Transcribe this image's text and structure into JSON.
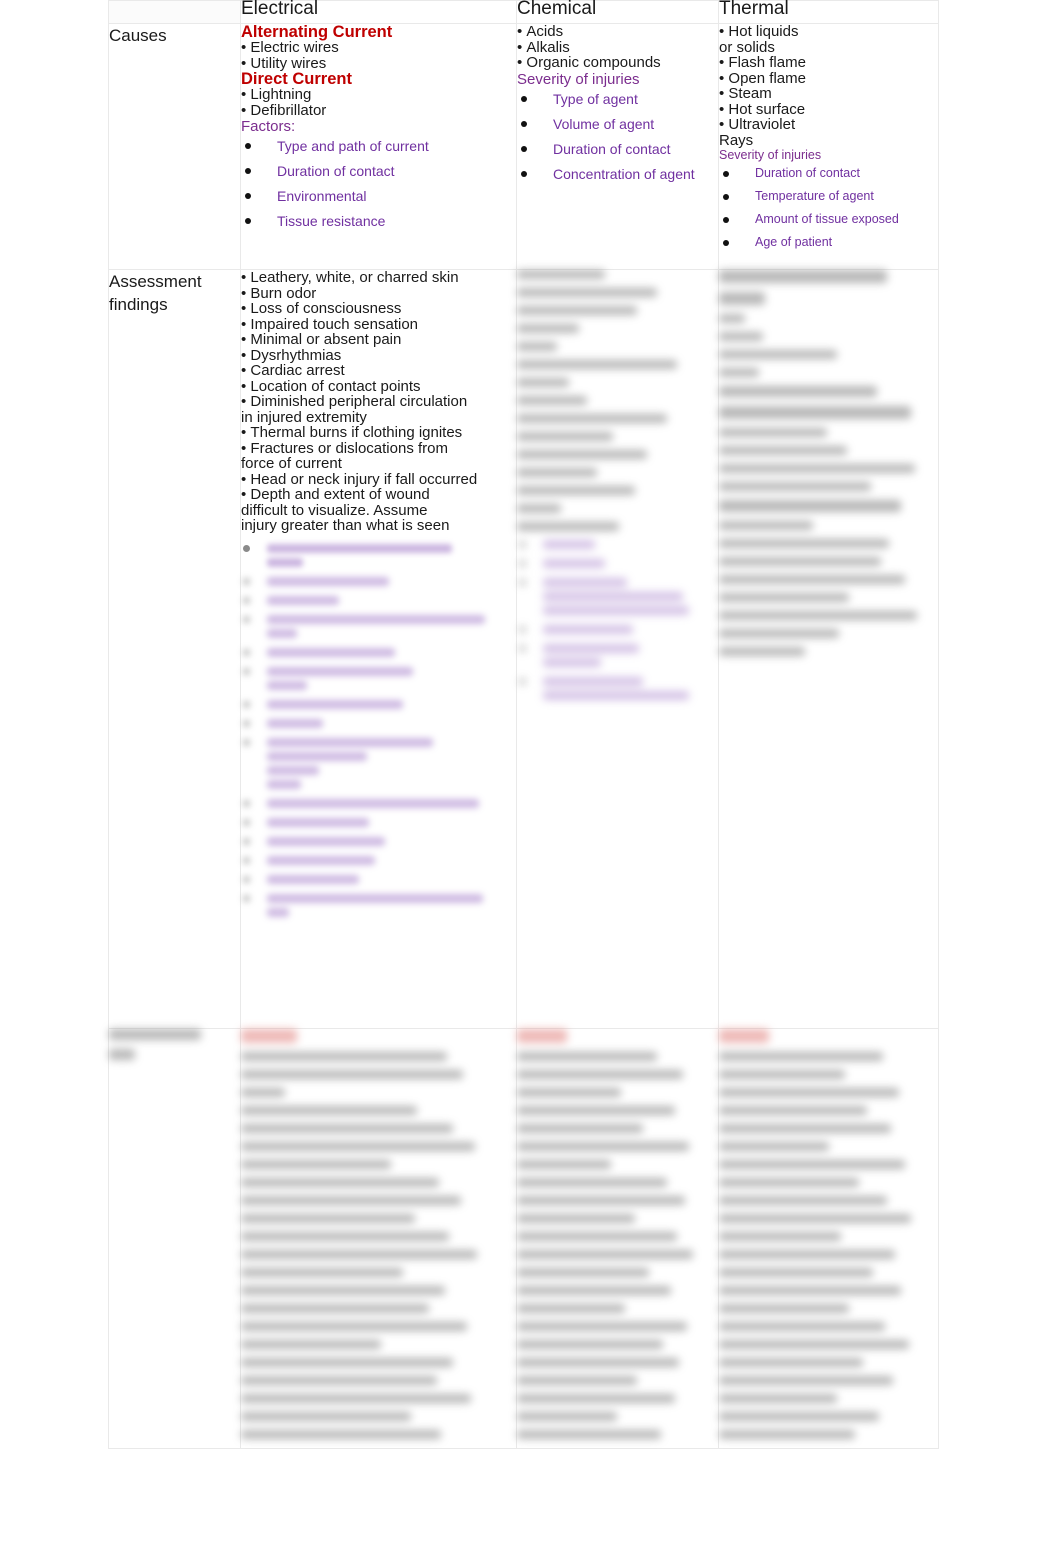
{
  "table": {
    "columns": [
      {
        "key": "label",
        "header": ""
      },
      {
        "key": "electrical",
        "header": "Electrical"
      },
      {
        "key": "chemical",
        "header": "Chemical"
      },
      {
        "key": "thermal",
        "header": "Thermal"
      }
    ],
    "colors": {
      "heading_red": "#BF0000",
      "sub_purple": "#7030A0",
      "sub_head_purple": "#7B2D8E",
      "body_text": "#1A1A1A",
      "cell_border": "#E9E9E9",
      "page_background": "#FFFFFF"
    },
    "rows": [
      {
        "label": "Causes",
        "electrical": {
          "red_heading_1": "Alternating Current",
          "bullets_1": [
            "Electric wires",
            "Utility wires"
          ],
          "red_heading_2": "Direct Current",
          "bullets_2": [
            "Lightning",
            "Defibrillator"
          ],
          "sub_head": "Factors:",
          "sub_bullets": [
            "Type and path of current",
            "Duration of contact",
            "Environmental",
            "Tissue resistance"
          ]
        },
        "chemical": {
          "bullets": [
            "Acids",
            "Alkalis",
            "Organic compounds"
          ],
          "sub_head": "Severity of injuries",
          "sub_bullets": [
            "Type of agent",
            "Volume of agent",
            "Duration of contact",
            "Concentration of agent"
          ]
        },
        "thermal": {
          "bullets": [
            "Hot liquids",
            "or solids",
            "Flash flame",
            "Open flame",
            "Steam",
            "Hot surface",
            "Ultraviolet",
            "Rays"
          ],
          "bullets_continuation_indexes": [
            1,
            7
          ],
          "sub_head": "Severity of injuries",
          "sub_bullets": [
            "Duration of contact",
            "Temperature of agent",
            "Amount of tissue exposed",
            "Age of patient"
          ]
        }
      },
      {
        "label": "Assessment findings",
        "electrical": {
          "bullets": [
            "Leathery, white, or charred skin",
            "Burn odor",
            "Loss of consciousness",
            "Impaired touch sensation",
            "Minimal or absent pain",
            "Dysrhythmias",
            "Cardiac arrest",
            "Location of contact points",
            "Diminished peripheral circulation",
            "in injured extremity",
            "Thermal burns if clothing ignites",
            "Fractures or dislocations from",
            "force of current",
            "Head or neck injury if fall occurred",
            "Depth and extent of wound",
            "difficult to visualize. Assume",
            "injury greater than what is seen"
          ],
          "bullets_continuation_indexes": [
            9,
            12,
            15,
            16
          ],
          "redacted_note": "Remaining sub-bulleted purple text in this cell is blurred and unreadable."
        },
        "chemical": {
          "redacted_note": "Entire cell content is blurred and unreadable."
        },
        "thermal": {
          "redacted_note": "Entire cell content is blurred and unreadable."
        }
      },
      {
        "label": "",
        "label_redacted_note": "Row label is blurred and unreadable (two lines of dark text).",
        "electrical": {
          "redacted_note": "Cell begins with a short red heading; remainder is blurred and unreadable."
        },
        "chemical": {
          "redacted_note": "Cell begins with a short red heading; remainder is blurred and unreadable."
        },
        "thermal": {
          "redacted_note": "Cell begins with a short red heading; remainder is blurred and unreadable."
        }
      }
    ]
  }
}
